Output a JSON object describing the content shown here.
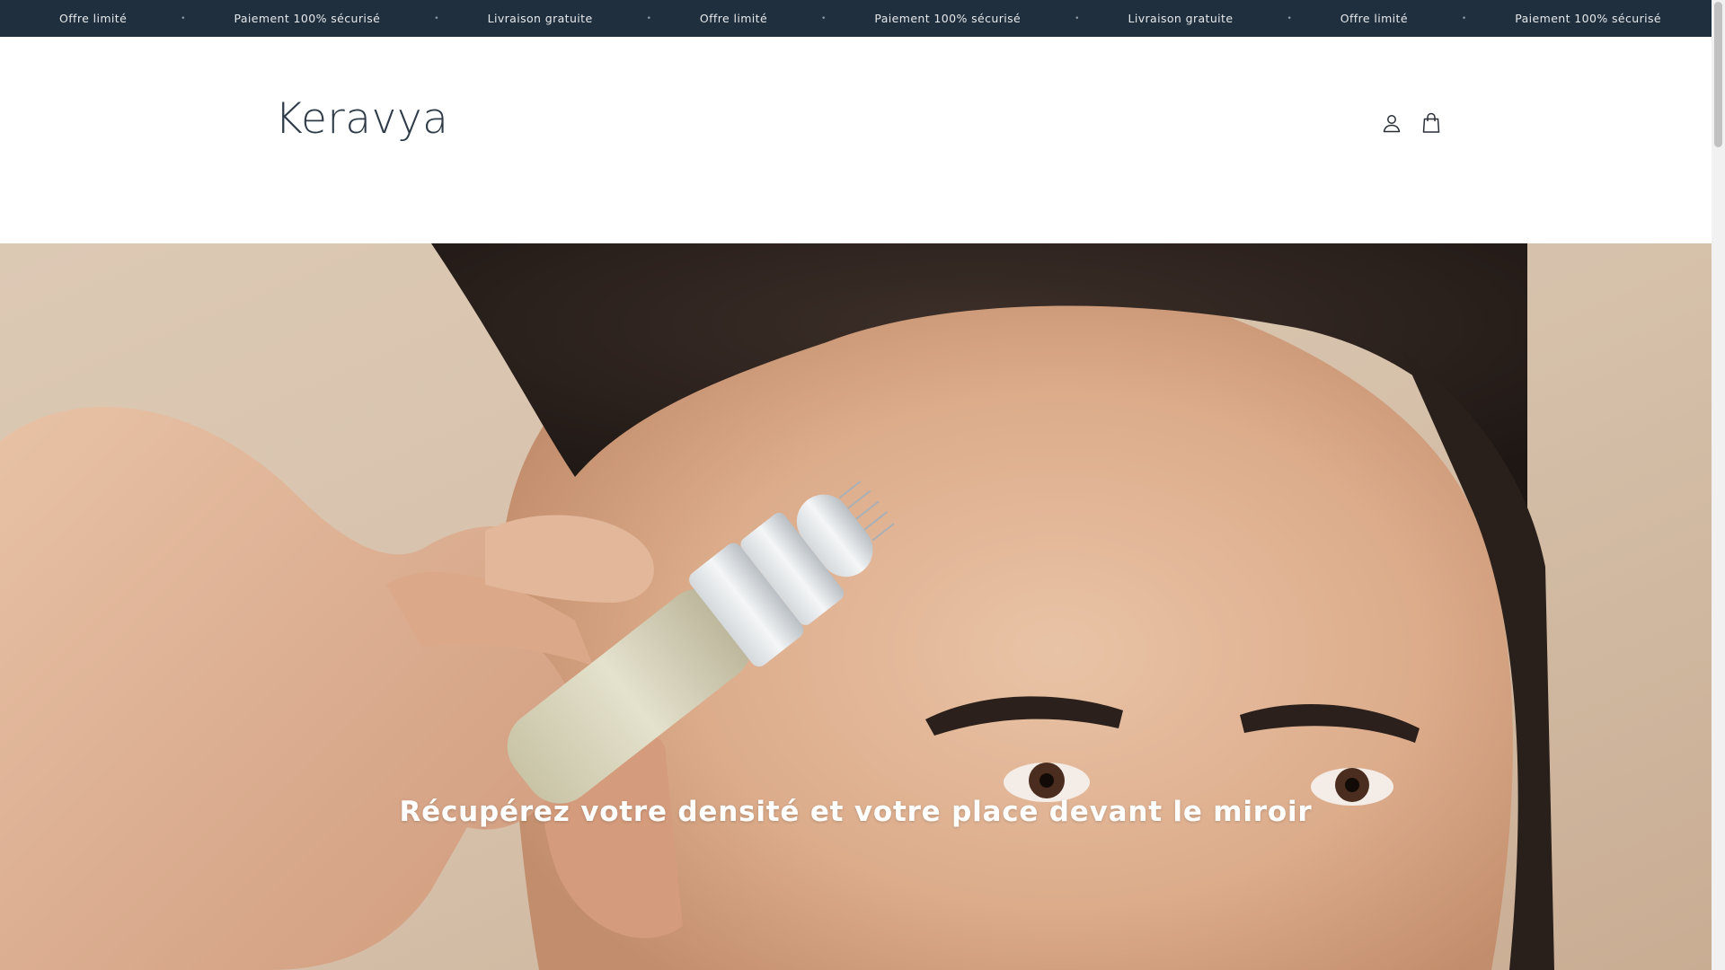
{
  "announcement_bar": {
    "background": "#1f2f3d",
    "items": [
      "Offre limité",
      "Paiement 100% sécurisé",
      "Livraison gratuite",
      "Offre limité",
      "Paiement 100% sécurisé",
      "Livraison gratuite",
      "Offre limité",
      "Paiement 100% sécurisé"
    ],
    "separator": "•"
  },
  "header": {
    "logo": "Keravya",
    "account_icon": "user-account-icon",
    "cart_icon": "shopping-bag-icon"
  },
  "hero": {
    "title": "Récupérez votre densité et votre place devant le miroir"
  }
}
